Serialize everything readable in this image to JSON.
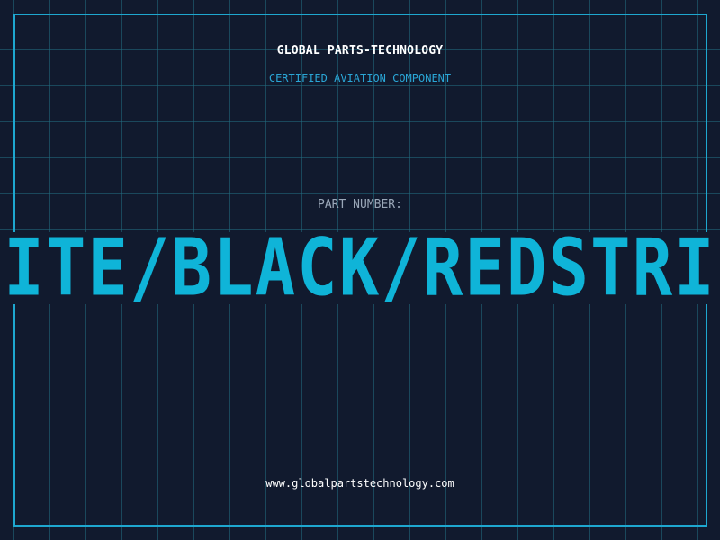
{
  "header": {
    "company": "GLOBAL PARTS-TECHNOLOGY",
    "certification": "CERTIFIED AVIATION COMPONENT"
  },
  "part": {
    "label": "PART NUMBER:",
    "value": "WHITE/BLACK/REDSTRIPE"
  },
  "footer": {
    "website": "www.globalpartstechnology.com"
  },
  "colors": {
    "background": "#111a2e",
    "grid": "#226e82",
    "accent": "#1ea7cf",
    "part_number": "#0fb4d8",
    "label": "#9aa7b8",
    "text": "#ffffff"
  }
}
